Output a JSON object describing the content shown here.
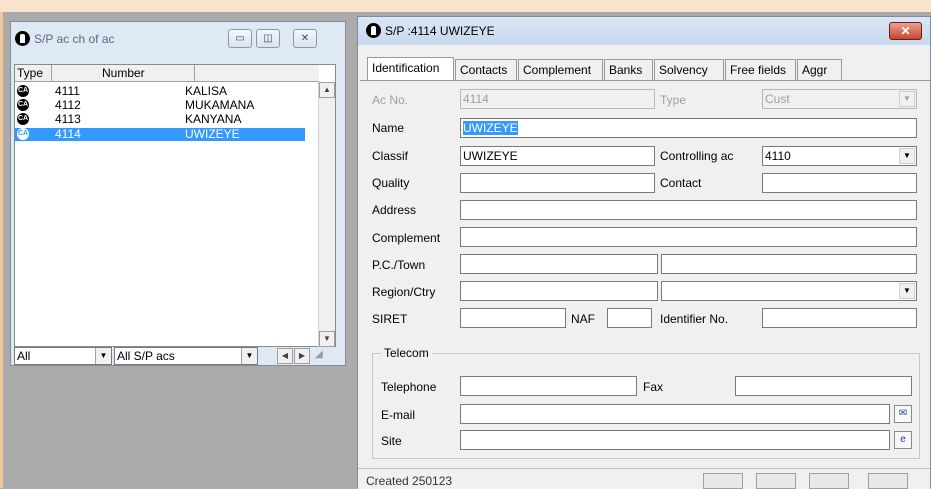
{
  "left_window": {
    "title": "S/P ac ch of ac",
    "controls": {
      "minimize": "▭",
      "restore": "◫",
      "close": "✕"
    },
    "columns": [
      "Type",
      "Number",
      ""
    ],
    "rows": [
      {
        "type": "CA",
        "number": "4111",
        "name": "KALISA"
      },
      {
        "type": "CA",
        "number": "4112",
        "name": "MUKAMANA"
      },
      {
        "type": "CA",
        "number": "4113",
        "name": "KANYANA"
      },
      {
        "type": "CA",
        "number": "4114",
        "name": "UWIZEYE"
      }
    ],
    "filter1": "All",
    "filter2": "All S/P acs"
  },
  "right_window": {
    "title": "S/P :4114 UWIZEYE",
    "close": "✕",
    "tabs": [
      "Identification",
      "Contacts",
      "Complement",
      "Banks",
      "Solvency",
      "Free fields",
      "Aggr"
    ],
    "fields": {
      "ac_no_label": "Ac No.",
      "ac_no": "4114",
      "type_label": "Type",
      "type": "Cust",
      "name_label": "Name",
      "name": "UWIZEYE",
      "classif_label": "Classif",
      "classif": "UWIZEYE",
      "controlling_label": "Controlling ac",
      "controlling": "4110",
      "quality_label": "Quality",
      "quality": "",
      "contact_label": "Contact",
      "contact": "",
      "address_label": "Address",
      "address": "",
      "complement_label": "Complement",
      "complement": "",
      "pc_town_label": "P.C./Town",
      "pc": "",
      "town": "",
      "region_label": "Region/Ctry",
      "region": "",
      "country": "",
      "siret_label": "SIRET",
      "siret": "",
      "naf_label": "NAF",
      "naf": "",
      "identifier_label": "Identifier No.",
      "identifier": ""
    },
    "telecom": {
      "group_label": "Telecom",
      "telephone_label": "Telephone",
      "telephone": "",
      "fax_label": "Fax",
      "fax": "",
      "email_label": "E-mail",
      "email": "",
      "site_label": "Site",
      "site": ""
    },
    "status": {
      "text": "Created 250123"
    }
  }
}
